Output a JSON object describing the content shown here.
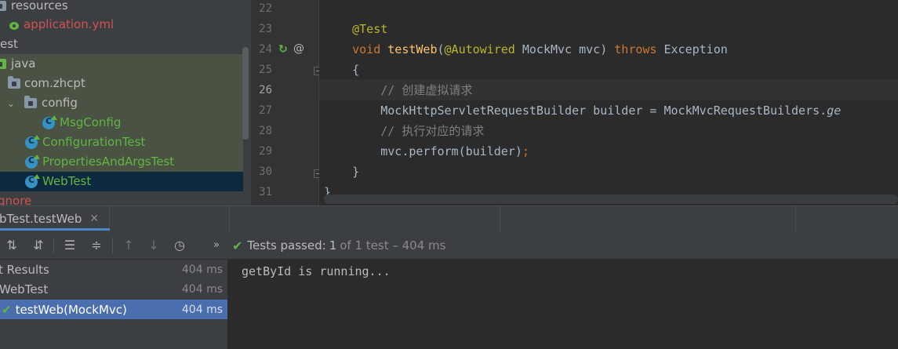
{
  "project_tree": {
    "items": [
      {
        "label": "resources"
      },
      {
        "label": "application.yml"
      },
      {
        "label": "est"
      },
      {
        "label": "java"
      },
      {
        "label": "com.zhcpt"
      },
      {
        "label": "config"
      },
      {
        "label": "MsgConfig"
      },
      {
        "label": "ConfigurationTest"
      },
      {
        "label": "PropertiesAndArgsTest"
      },
      {
        "label": "WebTest"
      },
      {
        "label": "gnore"
      }
    ]
  },
  "editor": {
    "lines": [
      {
        "number": "22",
        "tokens": []
      },
      {
        "number": "23",
        "tokens": [
          {
            "t": "    ",
            "c": "ty"
          },
          {
            "t": "@Test",
            "c": "ann"
          }
        ]
      },
      {
        "number": "24",
        "tokens": [
          {
            "t": "    ",
            "c": "ty"
          },
          {
            "t": "void ",
            "c": "kw"
          },
          {
            "t": "testWeb",
            "c": "fn"
          },
          {
            "t": "(",
            "c": "ty"
          },
          {
            "t": "@Autowired",
            "c": "ann"
          },
          {
            "t": " MockMvc mvc) ",
            "c": "ty"
          },
          {
            "t": "throws",
            "c": "kw"
          },
          {
            "t": " Exception",
            "c": "ty"
          }
        ]
      },
      {
        "number": "25",
        "tokens": [
          {
            "t": "    {",
            "c": "ty"
          }
        ]
      },
      {
        "number": "26",
        "tokens": [
          {
            "t": "        ",
            "c": "ty"
          },
          {
            "t": "// 创建虚拟请求",
            "c": "cm"
          }
        ]
      },
      {
        "number": "27",
        "tokens": [
          {
            "t": "        MockHttpServletRequestBuilder builder = MockMvcRequestBuilders.",
            "c": "ty"
          },
          {
            "t": "ge",
            "c": "ty"
          }
        ]
      },
      {
        "number": "28",
        "tokens": [
          {
            "t": "        ",
            "c": "ty"
          },
          {
            "t": "// 执行对应的请求",
            "c": "cm"
          }
        ]
      },
      {
        "number": "29",
        "tokens": [
          {
            "t": "        mvc.perform(builder)",
            "c": "ty"
          },
          {
            "t": ";",
            "c": "punct"
          }
        ]
      },
      {
        "number": "30",
        "tokens": [
          {
            "t": "    }",
            "c": "ty"
          }
        ]
      },
      {
        "number": "31",
        "tokens": [
          {
            "t": "}",
            "c": "ty"
          }
        ]
      }
    ],
    "current_line": "26"
  },
  "run_window": {
    "tab_label": "bTest.testWeb",
    "close_glyph": "✕",
    "status": {
      "passed_label": "Tests passed:",
      "count": "1",
      "rest": "of 1 test – 404 ms"
    },
    "results": [
      {
        "label": "t Results",
        "time": "404 ms"
      },
      {
        "label": "WebTest",
        "time": "404 ms"
      },
      {
        "label": "testWeb(MockMvc)",
        "time": "404 ms"
      }
    ],
    "console": "getById is running..."
  },
  "icons": {
    "sort_alpha": "sort-alphabetically-icon",
    "sort_duration": "sort-by-duration-icon",
    "expand_all": "expand-all-icon",
    "collapse_all": "collapse-all-icon",
    "prev_failed": "previous-failed-icon",
    "next_failed": "next-failed-icon",
    "history": "test-history-icon"
  },
  "colors": {
    "accent": "#4a88c7",
    "pass": "#62b543",
    "selection": "#4b6eaf"
  }
}
